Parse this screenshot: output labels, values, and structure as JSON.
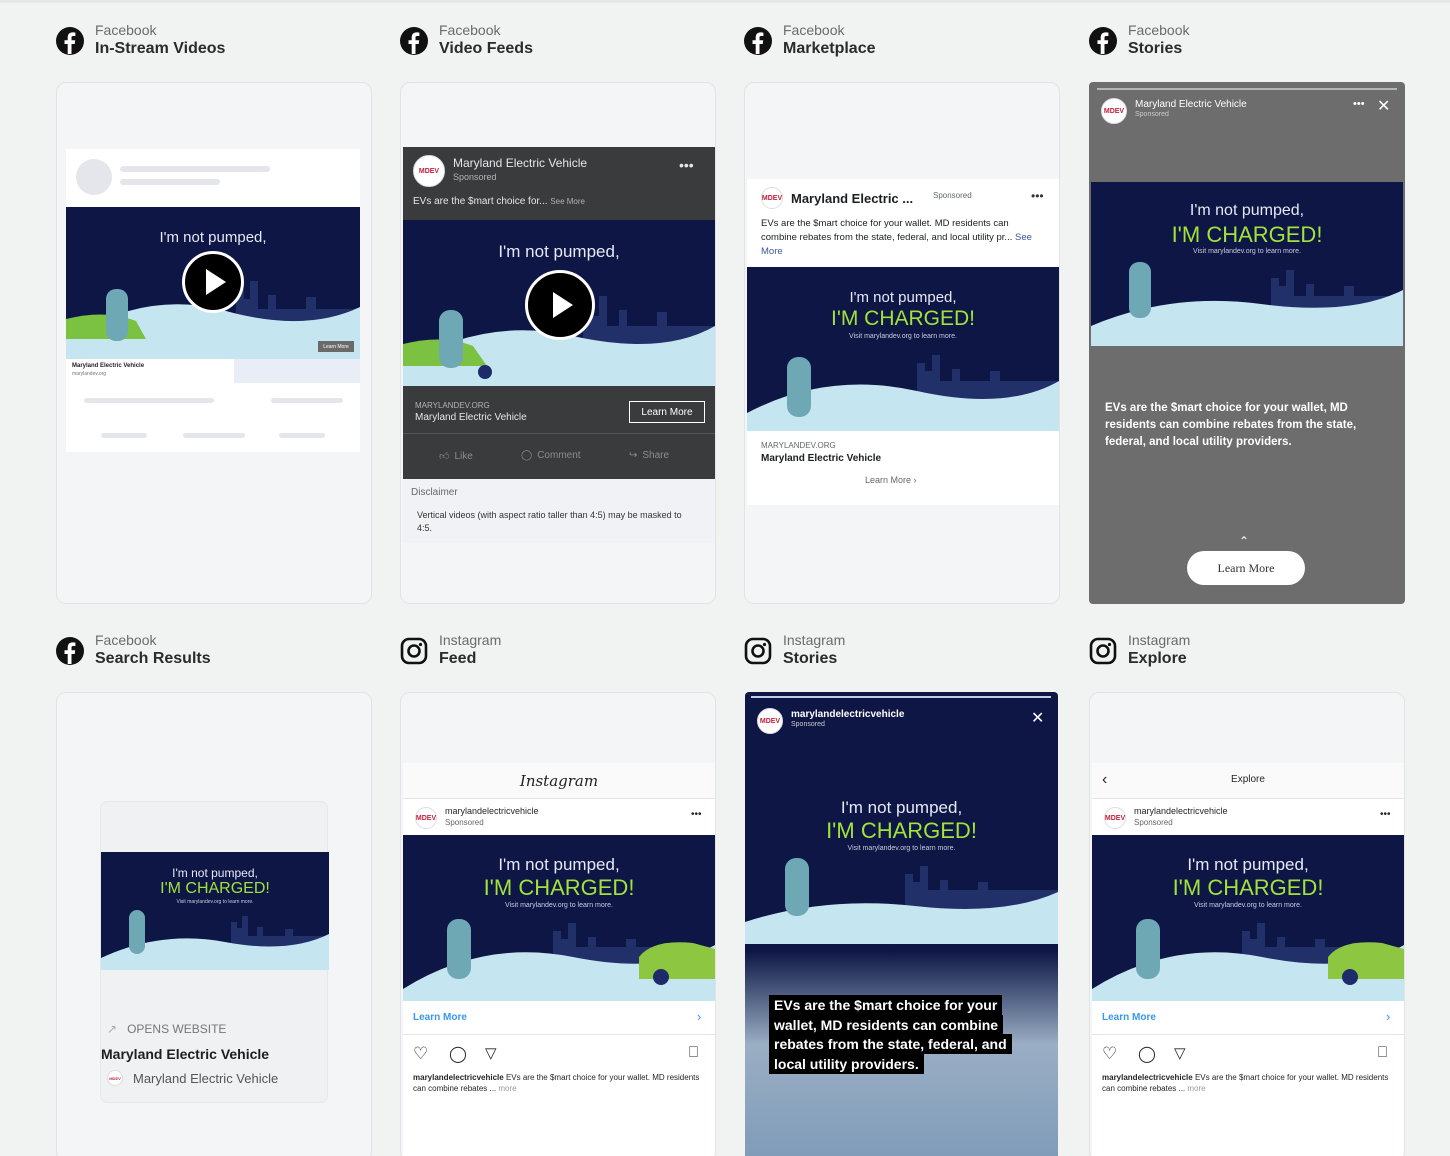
{
  "placements": [
    {
      "network": "Facebook",
      "name": "In-Stream Videos"
    },
    {
      "network": "Facebook",
      "name": "Video Feeds"
    },
    {
      "network": "Facebook",
      "name": "Marketplace"
    },
    {
      "network": "Facebook",
      "name": "Stories"
    },
    {
      "network": "Facebook",
      "name": "Search Results"
    },
    {
      "network": "Instagram",
      "name": "Feed"
    },
    {
      "network": "Instagram",
      "name": "Stories"
    },
    {
      "network": "Instagram",
      "name": "Explore"
    }
  ],
  "ad": {
    "brand": "Maryland Electric Vehicle",
    "brand_short": "Maryland Electric ...",
    "sponsored": "Sponsored",
    "handle": "marylandelectricvehicle",
    "headline_1": "I'm not pumped,",
    "headline_2": "I'M CHARGED!",
    "subline": "Visit marylandev.org to learn more.",
    "body_short": "EVs are the $mart choice for...",
    "see_more": "See More",
    "body_marketplace": "EVs are the $mart choice for your wallet. MD residents can combine rebates from the state, federal, and local utility pr...",
    "body_full": "EVs are the $mart choice for your wallet, MD residents can combine rebates from the state, federal, and local utility providers.",
    "domain": "MARYLANDEV.ORG",
    "learn_more": "Learn More",
    "learn_more_arrow": "Learn More ›",
    "opens_website": "OPENS WEBSITE",
    "avatar": "MDEV",
    "disclaimer_title": "Disclaimer",
    "disclaimer_text": "Vertical videos (with aspect ratio taller than 4:5) may be masked to 4:5.",
    "like": "Like",
    "comment": "Comment",
    "share": "Share",
    "instagram": "Instagram",
    "explore": "Explore",
    "ig_caption_handle": "marylandelectricvehicle",
    "ig_caption": "EVs are the $mart choice for your wallet. MD residents can combine rebates ...",
    "more": "more",
    "instream_brand": "Maryland Electric Vehicle",
    "instream_sub": "marylandev.org"
  },
  "colors": {
    "navy": "#0d1645",
    "green": "#a2e23a",
    "snow": "#c5e6f1",
    "fb_dark": "#3a3b3c",
    "ig_blue": "#3897f0"
  }
}
